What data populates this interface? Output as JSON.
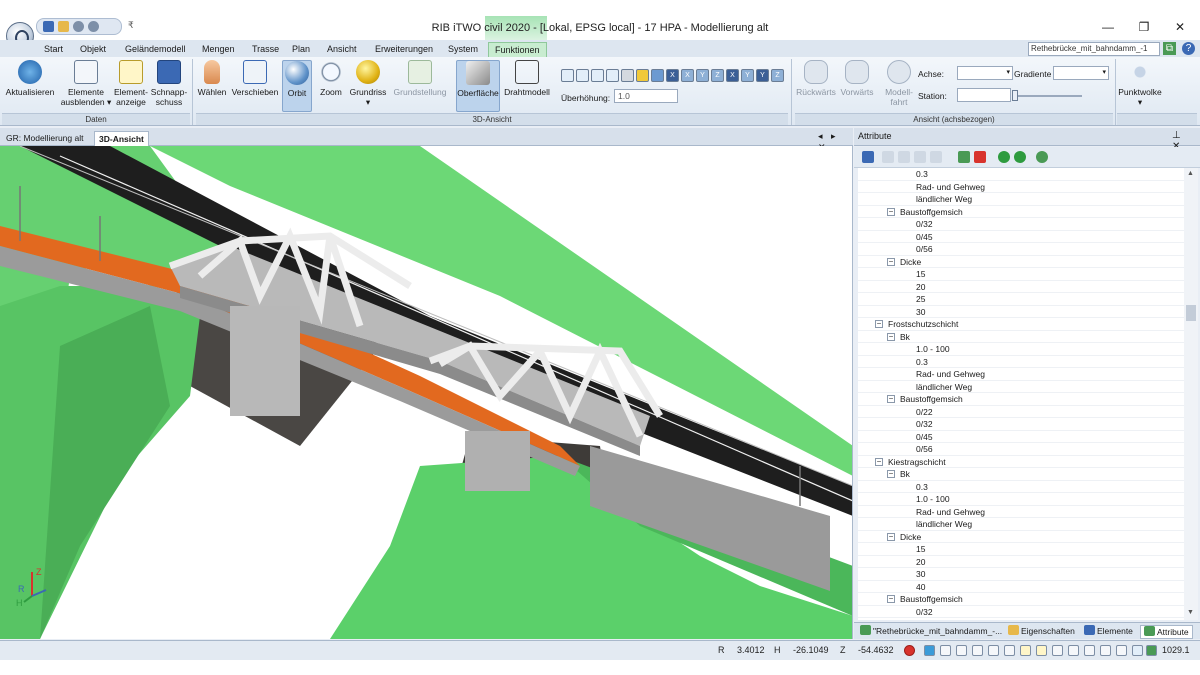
{
  "window": {
    "title": "RIB iTWO civil 2020 - [Lokal, EPSG local] - 17 HPA - Modellierung alt",
    "minimize": "—",
    "maximize": "❐",
    "close": "✕"
  },
  "qat": {
    "dropdown": "₹"
  },
  "ribbon_tabs": [
    "Start",
    "Objekt",
    "Geländemodell",
    "Mengen",
    "Trasse",
    "Plan",
    "Ansicht",
    "Erweiterungen",
    "System",
    "Funktionen"
  ],
  "document_combo": "Rethebrücke_mit_bahndamm_-1",
  "ribbon": {
    "groups": {
      "daten": "Daten",
      "ansicht3d": "3D-Ansicht",
      "ansicht_achs": "Ansicht (achsbezogen)"
    },
    "buttons": {
      "aktualisieren": "Aktualisieren",
      "elemente_ausblenden_1": "Elemente",
      "elemente_ausblenden_2": "ausblenden ▾",
      "elementanzeige_1": "Element-",
      "elementanzeige_2": "anzeige",
      "schnappschuss_1": "Schnapp-",
      "schnappschuss_2": "schuss",
      "waehlen": "Wählen",
      "verschieben": "Verschieben",
      "orbit": "Orbit",
      "zoom": "Zoom",
      "grundriss": "Grundriss",
      "grundstellung": "Grundstellung",
      "oberflaeche": "Oberfläche",
      "drahtmodell": "Drahtmodell",
      "rueckwaerts": "Rückwärts",
      "vorwaerts": "Vorwärts",
      "modellfahrt_1": "Modell-",
      "modellfahrt_2": "fahrt",
      "punktwolke": "Punktwolke"
    },
    "ueberhoehung_label": "Überhöhung:",
    "ueberhoehung_value": "1.0",
    "achse_label": "Achse:",
    "gradiente_label": "Gradiente",
    "station_label": "Station:"
  },
  "doc_tabs": [
    "GR: Modellierung alt",
    "3D-Ansicht"
  ],
  "doc_tab_controls": "◂ ▸ ✕",
  "attributes": {
    "title": "Attribute",
    "controls": "⊥ ✕",
    "rows": [
      {
        "text": "0.3",
        "level": 3
      },
      {
        "text": "Rad- und Gehweg",
        "level": 3
      },
      {
        "text": "ländlicher Weg",
        "level": 3
      },
      {
        "text": "Baustoffgemsich",
        "level": 2,
        "expander": "−"
      },
      {
        "text": "0/32",
        "level": 3
      },
      {
        "text": "0/45",
        "level": 3
      },
      {
        "text": "0/56",
        "level": 3
      },
      {
        "text": "Dicke",
        "level": 2,
        "expander": "−"
      },
      {
        "text": "15",
        "level": 3
      },
      {
        "text": "20",
        "level": 3
      },
      {
        "text": "25",
        "level": 3
      },
      {
        "text": "30",
        "level": 3
      },
      {
        "text": "Frostschutzschicht",
        "level": 1,
        "expander": "−"
      },
      {
        "text": "Bk",
        "level": 2,
        "expander": "−"
      },
      {
        "text": "1.0 - 100",
        "level": 3
      },
      {
        "text": "0.3",
        "level": 3
      },
      {
        "text": "Rad- und Gehweg",
        "level": 3
      },
      {
        "text": "ländlicher Weg",
        "level": 3
      },
      {
        "text": "Baustoffgemsich",
        "level": 2,
        "expander": "−"
      },
      {
        "text": "0/22",
        "level": 3
      },
      {
        "text": "0/32",
        "level": 3
      },
      {
        "text": "0/45",
        "level": 3
      },
      {
        "text": "0/56",
        "level": 3
      },
      {
        "text": "Kiestragschicht",
        "level": 1,
        "expander": "−"
      },
      {
        "text": "Bk",
        "level": 2,
        "expander": "−"
      },
      {
        "text": "0.3",
        "level": 3
      },
      {
        "text": "1.0 - 100",
        "level": 3
      },
      {
        "text": "Rad- und Gehweg",
        "level": 3
      },
      {
        "text": "ländlicher Weg",
        "level": 3
      },
      {
        "text": "Dicke",
        "level": 2,
        "expander": "−"
      },
      {
        "text": "15",
        "level": 3
      },
      {
        "text": "20",
        "level": 3
      },
      {
        "text": "30",
        "level": 3
      },
      {
        "text": "40",
        "level": 3
      },
      {
        "text": "Baustoffgemsich",
        "level": 2,
        "expander": "−"
      },
      {
        "text": "0/32",
        "level": 3
      }
    ]
  },
  "panel_tabs": [
    "\"Rethebrücke_mit_bahndamm_-...",
    "Eigenschaften",
    "Elemente",
    "Attribute"
  ],
  "axis_gizmo": {
    "z": "Z",
    "r": "R",
    "h": "H"
  },
  "status": {
    "r_label": "R",
    "r_value": "3.4012",
    "h_label": "H",
    "h_value": "-26.1049",
    "z_label": "Z",
    "z_value": "-54.4632",
    "zoom_value": "1029.1"
  },
  "colors": {
    "ribbon_bg": "#dfe8f2",
    "functions_tab": "#c8ecd0",
    "terrain_green": "#5ed46a",
    "road_asphalt": "#1e1e1e",
    "rail_orange": "#e2691f",
    "steel_truss": "#e8e8e8"
  }
}
